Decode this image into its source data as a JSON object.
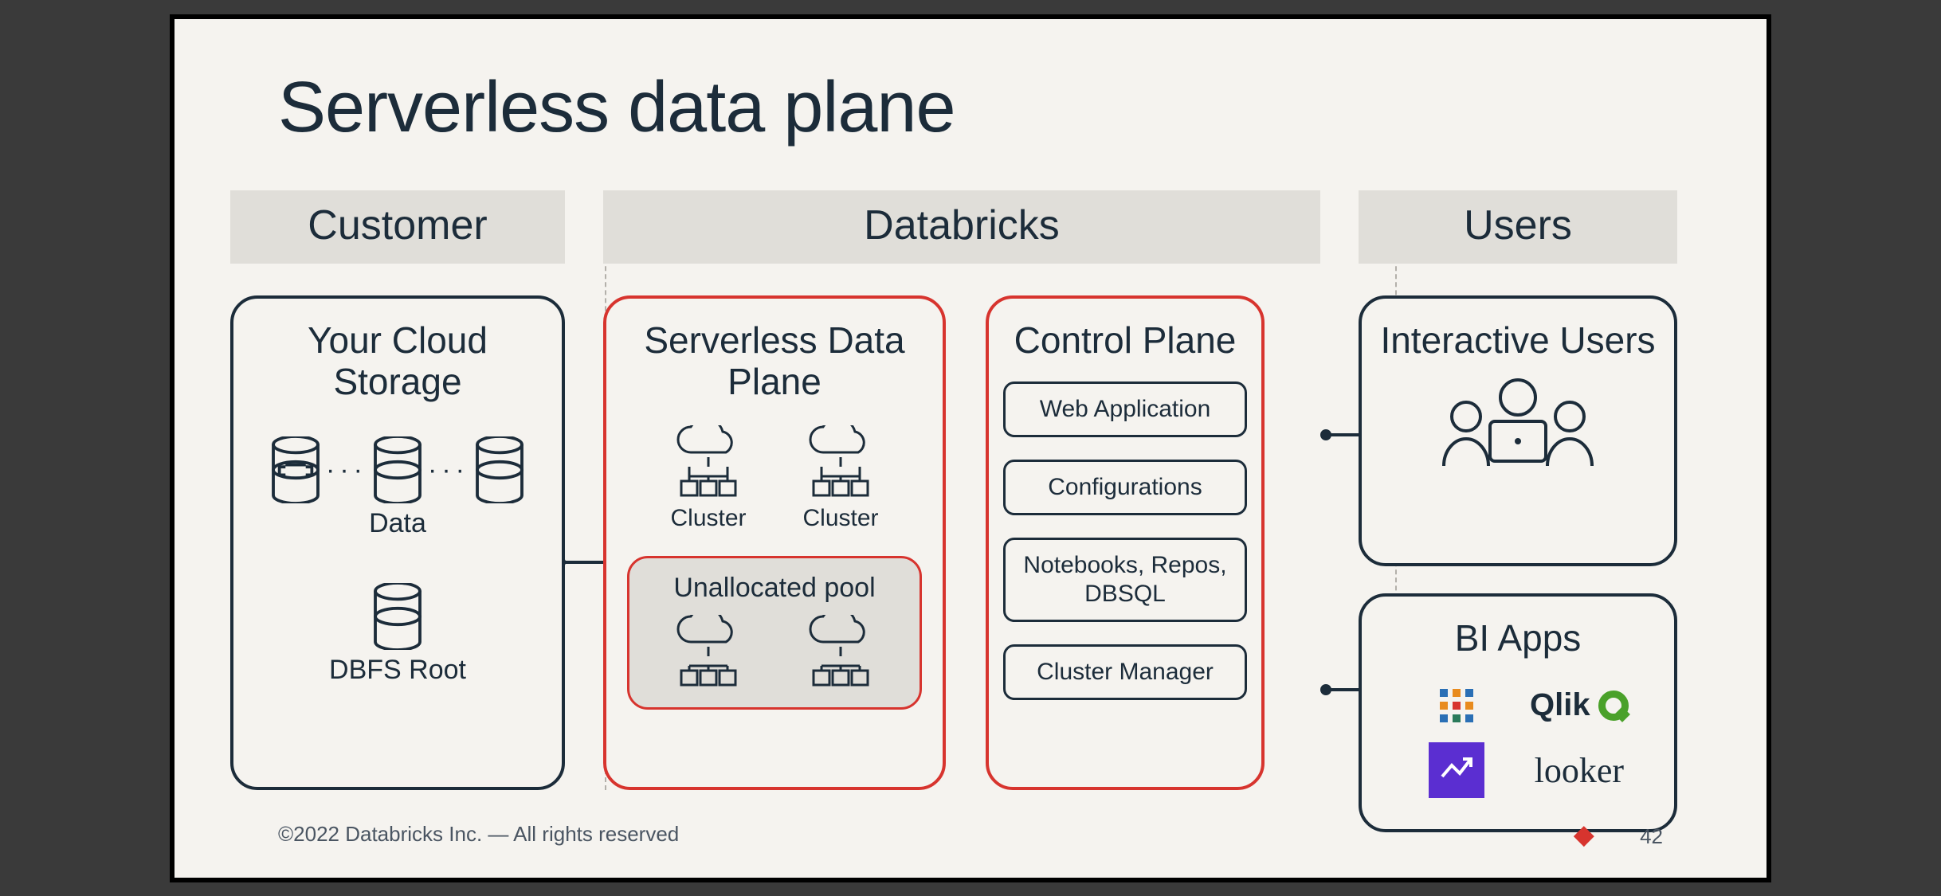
{
  "title": "Serverless data plane",
  "columns": {
    "customer": "Customer",
    "databricks": "Databricks",
    "users": "Users"
  },
  "storage": {
    "title": "Your Cloud Storage",
    "data_label": "Data",
    "dbfs_label": "DBFS Root"
  },
  "sdp": {
    "title": "Serverless Data Plane",
    "cluster_label": "Cluster",
    "pool_title": "Unallocated pool"
  },
  "control_plane": {
    "title": "Control Plane",
    "items": [
      "Web Application",
      "Configurations",
      "Notebooks, Repos, DBSQL",
      "Cluster Manager"
    ]
  },
  "users_col": {
    "interactive_title": "Interactive Users",
    "bi_title": "BI Apps",
    "bi_logos": {
      "tableau": "tableau",
      "qlik": "Qlik",
      "insights": "✓",
      "looker": "looker"
    }
  },
  "footer": {
    "copyright": "©2022 Databricks Inc. — All rights reserved",
    "page": "42"
  }
}
